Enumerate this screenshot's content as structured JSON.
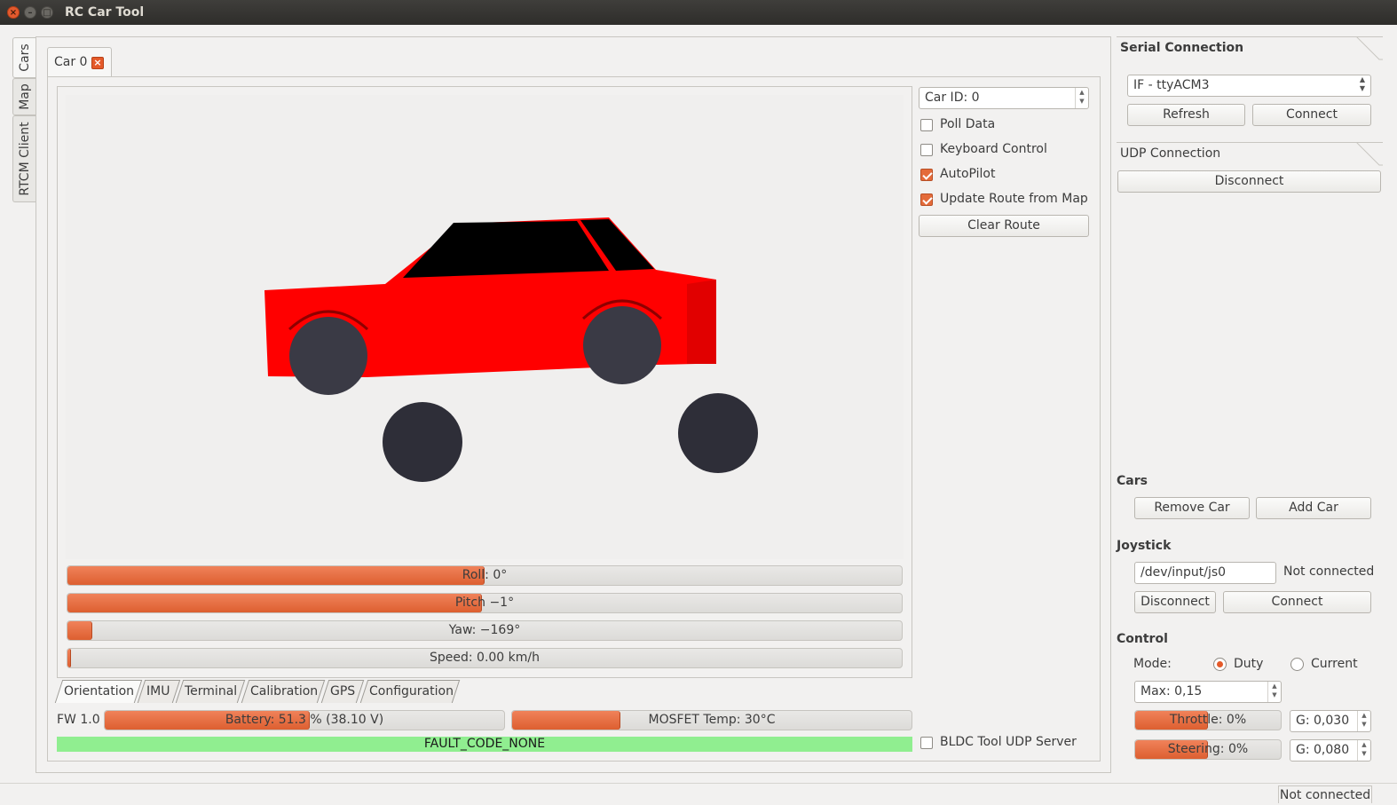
{
  "window": {
    "title": "RC Car Tool"
  },
  "side_tabs": [
    "Cars",
    "Map",
    "RTCM Client"
  ],
  "car_tab": {
    "label": "Car 0"
  },
  "car_controls": {
    "car_id": "Car ID: 0",
    "poll_data": {
      "label": "Poll Data",
      "checked": false
    },
    "keyboard_control": {
      "label": "Keyboard Control",
      "checked": false
    },
    "autopilot": {
      "label": "AutoPilot",
      "checked": true
    },
    "update_route": {
      "label": "Update Route from Map",
      "checked": true
    },
    "clear_route": "Clear Route"
  },
  "orientation_bars": [
    {
      "label": "Roll: 0°",
      "fraction": 0.5
    },
    {
      "label": "Pitch −1°",
      "fraction": 0.497
    },
    {
      "label": "Yaw: −169°",
      "fraction": 0.03
    },
    {
      "label": "Speed: 0.00 km/h",
      "fraction": 0.004
    }
  ],
  "bottom_tabs": [
    "Orientation",
    "IMU",
    "Terminal",
    "Calibration",
    "GPS",
    "Configuration"
  ],
  "status": {
    "fw": "FW 1.0",
    "battery": {
      "label": "Battery: 51.3 % (38.10 V)",
      "fraction": 0.513
    },
    "mosfet": {
      "label": "MOSFET Temp: 30°C",
      "fraction": 0.27
    },
    "fault": "FAULT_CODE_NONE",
    "bldc_udp": {
      "label": "BLDC Tool UDP Server",
      "checked": false
    }
  },
  "serial": {
    "title": "Serial Connection",
    "port": "IF - ttyACM3",
    "refresh": "Refresh",
    "connect": "Connect"
  },
  "udp": {
    "title": "UDP Connection",
    "disconnect": "Disconnect"
  },
  "cars": {
    "title": "Cars",
    "remove": "Remove Car",
    "add": "Add Car"
  },
  "joystick": {
    "title": "Joystick",
    "device": "/dev/input/js0",
    "status": "Not connected",
    "disconnect": "Disconnect",
    "connect": "Connect"
  },
  "control": {
    "title": "Control",
    "mode_label": "Mode:",
    "mode_duty": "Duty",
    "mode_current": "Current",
    "selected_mode": "Duty",
    "max": "Max: 0,15",
    "throttle": {
      "label": "Throttle: 0%",
      "fraction": 0.5,
      "gain": "G: 0,030"
    },
    "steering": {
      "label": "Steering: 0%",
      "fraction": 0.5,
      "gain": "G: 0,080"
    }
  },
  "statusbar": {
    "text": "Not connected"
  },
  "colors": {
    "accent": "#e45a2a",
    "fault_ok": "#90ee90",
    "car_body": "#ff0000",
    "wheel": "#3a3a45"
  }
}
